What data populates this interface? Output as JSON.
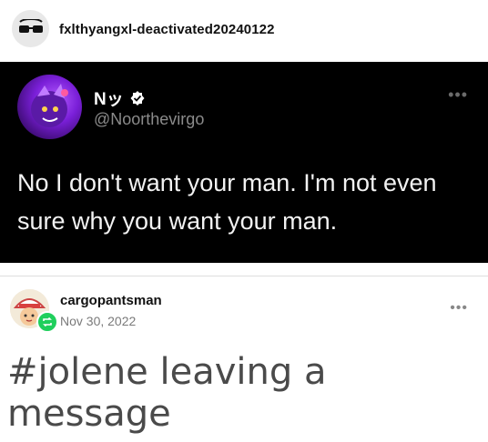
{
  "post": {
    "author": "fxlthyangxl-deactivated20240122"
  },
  "tweet": {
    "display_name": "Nッ",
    "handle": "@Noorthevirgo",
    "text": "No I don't want your man. I'm not even sure why you want your man.",
    "more_icon": "ellipsis-icon",
    "verified_icon": "verified-badge-icon"
  },
  "reblog": {
    "author": "cargopantsman",
    "date": "Nov 30, 2022",
    "content": "#jolene leaving a message",
    "badge_icon": "reblog-icon",
    "more_icon": "ellipsis-icon"
  },
  "colors": {
    "tweet_bg": "#000000",
    "reblog_badge": "#1fcf5c",
    "handle_gray": "#8b8b8b"
  }
}
